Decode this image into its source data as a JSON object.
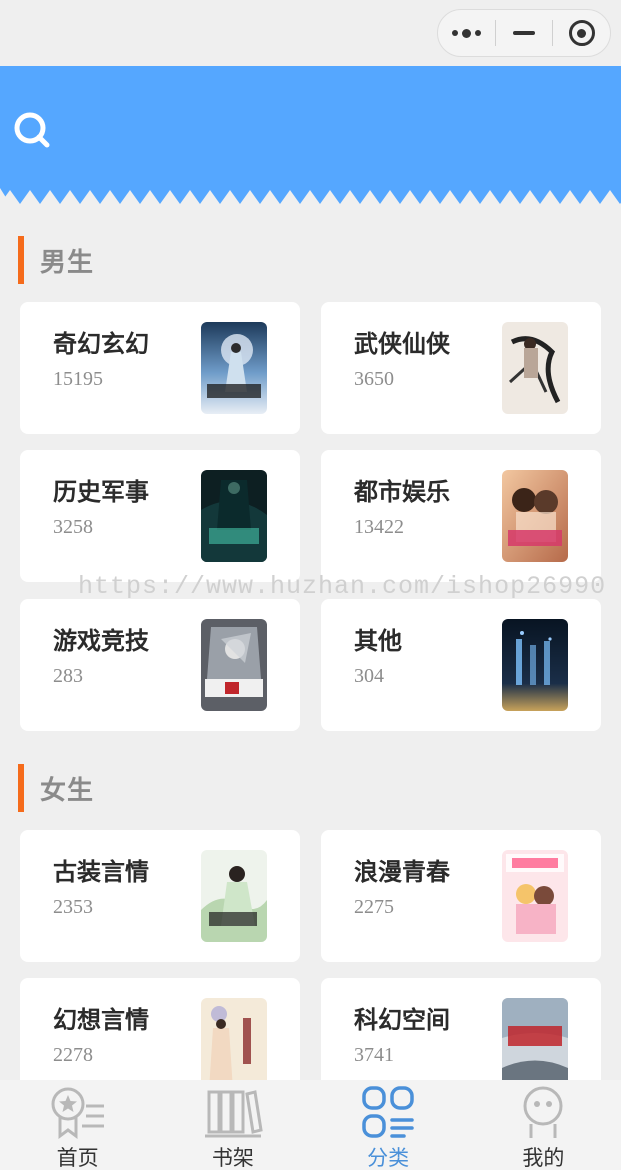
{
  "header": {
    "search_icon": "search-icon"
  },
  "sections": [
    {
      "title": "男生",
      "categories": [
        {
          "name": "奇幻玄幻",
          "count": "15195"
        },
        {
          "name": "武侠仙侠",
          "count": "3650"
        },
        {
          "name": "历史军事",
          "count": "3258"
        },
        {
          "name": "都市娱乐",
          "count": "13422"
        },
        {
          "name": "游戏竞技",
          "count": "283"
        },
        {
          "name": "其他",
          "count": "304"
        }
      ]
    },
    {
      "title": "女生",
      "categories": [
        {
          "name": "古装言情",
          "count": "2353"
        },
        {
          "name": "浪漫青春",
          "count": "2275"
        },
        {
          "name": "幻想言情",
          "count": "2278"
        },
        {
          "name": "科幻空间",
          "count": "3741"
        }
      ]
    }
  ],
  "watermark": "https://www.huzhan.com/ishop26990",
  "tabbar": {
    "active_index": 2,
    "tabs": [
      {
        "label": "首页",
        "icon": "home-badge-icon"
      },
      {
        "label": "书架",
        "icon": "bookshelf-icon"
      },
      {
        "label": "分类",
        "icon": "category-grid-icon"
      },
      {
        "label": "我的",
        "icon": "user-avatar-icon"
      }
    ]
  },
  "colors": {
    "header": "#55a7ff",
    "section_bar": "#f56b1b",
    "active_tab": "#4a90d9"
  }
}
